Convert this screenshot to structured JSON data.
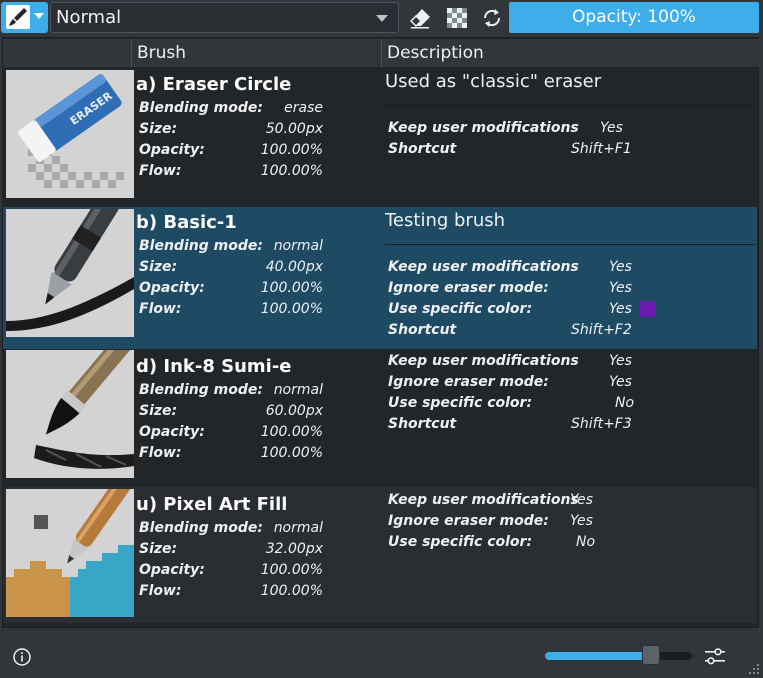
{
  "toolbar": {
    "preset_icon": "brush-preset-icon",
    "blend_mode": "Normal",
    "icons": [
      "eraser-icon",
      "checkerboard-icon",
      "reload-icon"
    ],
    "opacity_label": "Opacity: 100%",
    "opacity_percent": 100
  },
  "columns": {
    "brush": "Brush",
    "description": "Description"
  },
  "labels": {
    "blending_mode": "Blending mode:",
    "size": "Size:",
    "opacity": "Opacity:",
    "flow": "Flow:",
    "keep_user_mods": "Keep user modifications",
    "ignore_eraser": "Ignore eraser mode:",
    "use_specific_color": "Use specific color:",
    "shortcut": "Shortcut"
  },
  "presets": [
    {
      "name": "a) Eraser Circle",
      "blending_mode": "erase",
      "size": "50.00px",
      "opacity": "100.00%",
      "flow": "100.00%",
      "description": "Used as \"classic\" eraser",
      "keep_user_mods": "Yes",
      "shortcut": "Shift+F1",
      "selected": false
    },
    {
      "name": "b) Basic-1",
      "blending_mode": "normal",
      "size": "40.00px",
      "opacity": "100.00%",
      "flow": "100.00%",
      "description": "Testing brush",
      "keep_user_mods": "Yes",
      "ignore_eraser": "Yes",
      "use_specific_color": "Yes",
      "specific_color": "#6a1bb0",
      "shortcut": "Shift+F2",
      "selected": true
    },
    {
      "name": "d) Ink-8 Sumi-e",
      "blending_mode": "normal",
      "size": "60.00px",
      "opacity": "100.00%",
      "flow": "100.00%",
      "keep_user_mods": "Yes",
      "ignore_eraser": "Yes",
      "use_specific_color": "No",
      "shortcut": "Shift+F3",
      "selected": false
    },
    {
      "name": "u) Pixel Art Fill",
      "blending_mode": "normal",
      "size": "32.00px",
      "opacity": "100.00%",
      "flow": "100.00%",
      "keep_user_mods": "Yes",
      "ignore_eraser": "Yes",
      "use_specific_color": "No",
      "selected": false
    }
  ],
  "footer": {
    "info_icon": "info-icon",
    "zoom_slider_fraction": 0.72,
    "settings_icon": "settings-sliders-icon",
    "grip_icon": "resize-grip-icon"
  },
  "colors": {
    "accent": "#3daee9",
    "selected_row": "#1e4a63",
    "panel": "#232629",
    "window": "#31363b"
  }
}
